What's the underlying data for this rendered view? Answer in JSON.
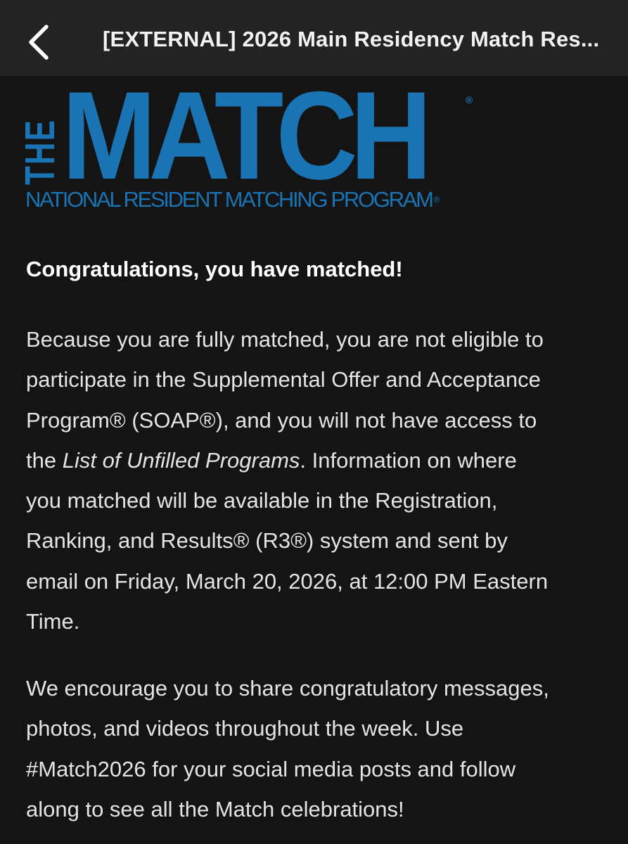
{
  "header": {
    "back_icon": "chevron-left-icon",
    "subject": "[EXTERNAL] 2026 Main Residency Match Res..."
  },
  "logo": {
    "the": "THE",
    "match": "MATCH",
    "registered": "®",
    "subtitle": "NATIONAL RESIDENT MATCHING PROGRAM",
    "subtitle_registered": "®",
    "color": "#1a74b4"
  },
  "body": {
    "heading": "Congratulations, you have matched!",
    "paragraph1": {
      "line1": "Because you are fully matched, you are not eligible to",
      "line2": "participate in the Supplemental Offer and Acceptance",
      "line3": "Program® (SOAP®), and you will not have access to",
      "line4_pre": "the ",
      "line4_italic": "List of Unfilled Programs",
      "line4_post": ". Information on where",
      "line5": "you matched will be available in the Registration,",
      "line6": "Ranking, and Results® (R3®) system and sent by",
      "line7": "email on Friday, March 20, 2026, at 12:00 PM Eastern",
      "line8": "Time."
    },
    "paragraph2": {
      "line1": "We encourage you to share congratulatory messages,",
      "line2": "photos, and videos throughout the week. Use",
      "line3": "#Match2026 for your social media posts and follow",
      "line4": "along to see all the Match celebrations!"
    }
  },
  "colors": {
    "background": "#141414",
    "header_bg": "#232323",
    "text": "#e4e4e4"
  }
}
